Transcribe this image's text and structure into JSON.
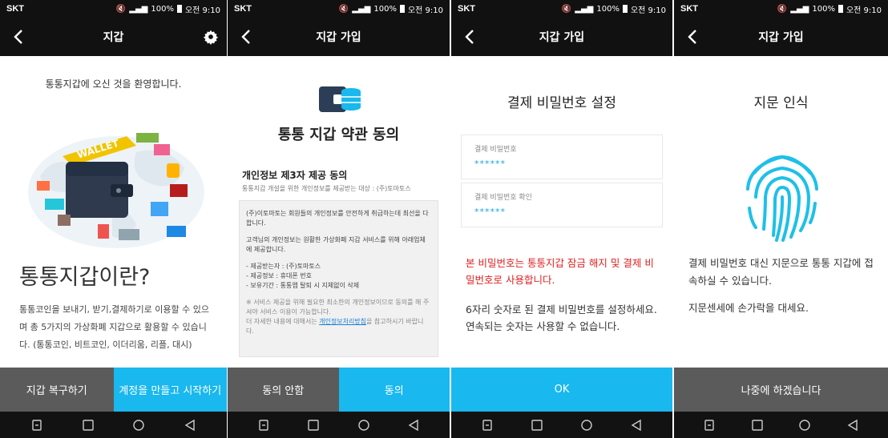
{
  "status": {
    "carrier": "SKT",
    "battery": "100%",
    "time": "오전 9:10"
  },
  "screen1": {
    "title": "지갑",
    "welcome": "통통지갑에 오신 것을 환영합니다.",
    "illustration_label": "WALLET",
    "big_title": "통통지갑이란?",
    "desc": "통통코인을 보내기, 받기,결제하기로 이용할 수 있으며 총 5가지의 가상화폐 지갑으로 활용할 수 있습니다. (통통코인, 비트코인, 이더리움, 리플, 대시)",
    "btn_restore": "지갑 복구하기",
    "btn_create": "계정을 만들고 시작하기"
  },
  "screen2": {
    "title": "지갑 가입",
    "terms_title": "통통 지갑 약관 동의",
    "section_title": "개인정보 제3자 제공 동의",
    "section_sub": "통통지갑 개설을 위한 개인정보를 제공받는 대상 : (주)토마토스",
    "p1": "(주)이토마토는 회원들의 개인정보를 안전하게 취급하는데 최선을 다합니다.",
    "p2": "고객님의 개인정보는 원활한 가상화폐 지갑 서비스를 위해 아래업체에 제공합니다.",
    "items": [
      "- 제공받는자 : (주)토마토스",
      "- 제공정보 : 휴대폰 번호",
      "- 보유기간 : 통통앱 탈퇴 시 지체없이 삭제"
    ],
    "note": "※ 서비스 제공을 위해 필요한 최소한의 개인정보이므로 동의를 해 주셔야 서비스 이용이 가능합니다.",
    "more_prefix": "더 자세한 내용에 대해서는 ",
    "more_link": "개인정보처리방침",
    "more_suffix": "을 참고하시기 바랍니다.",
    "btn_disagree": "동의 안함",
    "btn_agree": "동의"
  },
  "screen3": {
    "title": "지갑 가입",
    "heading": "결제 비밀번호 설정",
    "field1_label": "결제 비밀번호",
    "field1_value": "******",
    "field2_label": "결제 비밀번호 확인",
    "field2_value": "******",
    "warning": "본 비밀번호는 통통지갑 잠금 해지 및 결제 비밀번호로 사용합니다.",
    "info": "6자리 숫자로 된 결제 비밀번호를 설정하세요. 연속되는 숫자는 사용할 수 없습니다.",
    "btn_ok": "OK"
  },
  "screen4": {
    "title": "지갑 가입",
    "heading": "지문 인식",
    "info1": "결제 비밀번호 대신 지문으로 통통 지갑에 접속하실 수 있습니다.",
    "info2": "지문센세에 손가락을 대세요.",
    "btn_later": "나중에 하겠습니다"
  },
  "colors": {
    "accent": "#19b8ee",
    "button_gray": "#5b5b5b",
    "warning": "#e02020",
    "bar": "#111111"
  },
  "icons": [
    "back-arrow-icon",
    "gear-icon",
    "wallet-database-icon",
    "fingerprint-icon",
    "recent-apps-icon",
    "home-icon",
    "back-triangle-icon",
    "overview-icon"
  ]
}
